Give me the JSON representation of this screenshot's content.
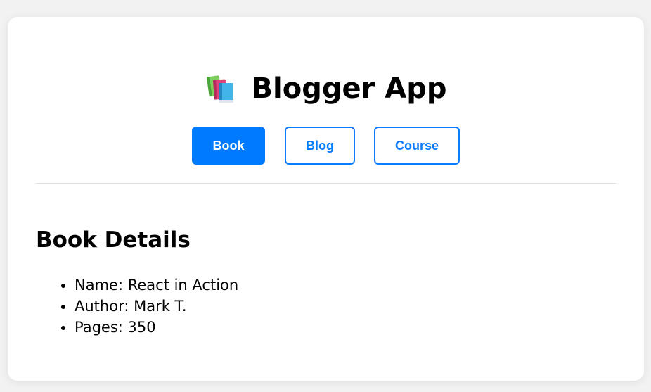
{
  "app": {
    "title": "Blogger App",
    "icon": "books-icon"
  },
  "nav": {
    "active": "Book",
    "buttons": [
      {
        "label": "Book"
      },
      {
        "label": "Blog"
      },
      {
        "label": "Course"
      }
    ]
  },
  "section": {
    "title": "Book Details",
    "items": [
      "Name: React in Action",
      "Author: Mark T.",
      "Pages: 350"
    ]
  },
  "colors": {
    "accent": "#007bff",
    "background": "#f2f2f2",
    "card": "#ffffff"
  }
}
